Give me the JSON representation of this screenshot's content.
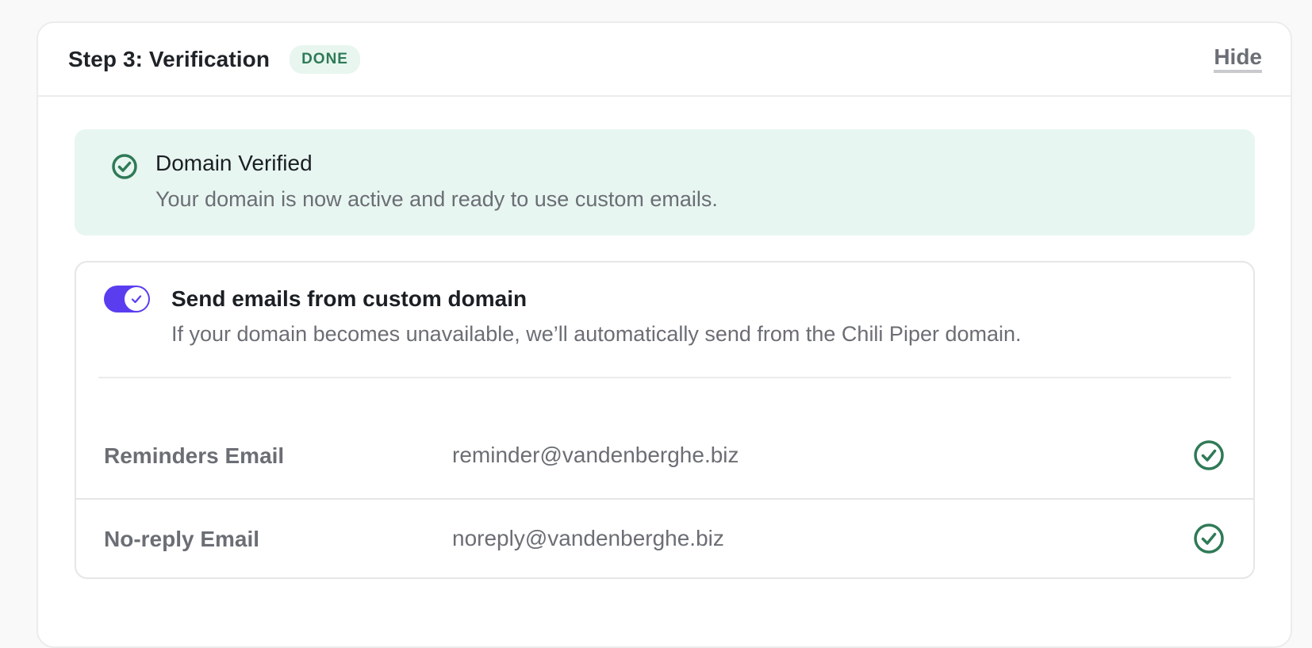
{
  "step": {
    "title": "Step 3: Verification",
    "status_badge": "DONE",
    "hide_label": "Hide"
  },
  "banner": {
    "icon": "check-circle-icon",
    "title": "Domain Verified",
    "message": "Your domain is now active and ready to use custom emails."
  },
  "custom_domain": {
    "toggle_on": true,
    "title": "Send emails from custom domain",
    "description": "If your domain becomes unavailable, we’ll automatically send from the Chili Piper domain."
  },
  "emails": [
    {
      "label": "Reminders Email",
      "value": "reminder@vandenberghe.biz",
      "status_icon": "check-circle-icon"
    },
    {
      "label": "No-reply Email",
      "value": "noreply@vandenberghe.biz",
      "status_icon": "check-circle-icon"
    }
  ],
  "colors": {
    "accent": "#5b3df0",
    "success": "#2f7a57",
    "success_bg": "#e8f6f1"
  }
}
